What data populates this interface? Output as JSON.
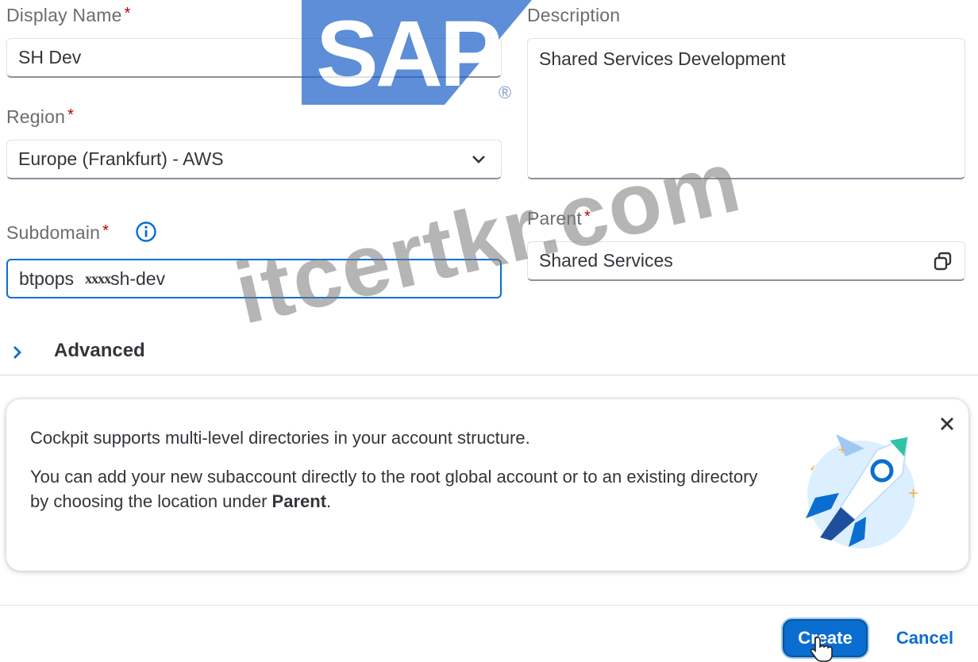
{
  "form": {
    "display_name": {
      "label": "Display Name",
      "required_mark": "*",
      "value": "SH Dev"
    },
    "region": {
      "label": "Region",
      "required_mark": "*",
      "value": "Europe (Frankfurt) - AWS"
    },
    "subdomain": {
      "label": "Subdomain",
      "required_mark": "*",
      "value_prefix": "btpops",
      "value_redacted": "xxxx",
      "value_suffix": "sh-dev"
    },
    "description": {
      "label": "Description",
      "value": "Shared Services Development"
    },
    "parent": {
      "label": "Parent",
      "required_mark": "*",
      "value": "Shared Services"
    },
    "advanced": {
      "label": "Advanced"
    }
  },
  "banner": {
    "line1": "Cockpit supports multi-level directories in your account structure.",
    "line2_before": "You can add your new subaccount directly to the root global account or to an existing directory by choosing the location under ",
    "line2_bold": "Parent",
    "line2_after": "."
  },
  "actions": {
    "create_label": "Create",
    "cancel_label": "Cancel"
  },
  "overlays": {
    "logo_text": "SAP",
    "logo_registered": "®",
    "watermark_text": "itcertkr.com"
  },
  "colors": {
    "accent": "#0a6ed1",
    "required": "#bb0000",
    "logo_blue": "#1f64c8"
  },
  "icons": [
    "info-icon",
    "chevron-down-icon",
    "copy-icon",
    "chevron-right-icon",
    "close-icon",
    "rocket-illustration",
    "hand-cursor-icon"
  ]
}
